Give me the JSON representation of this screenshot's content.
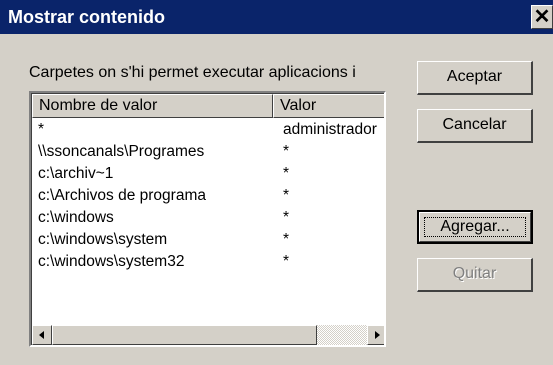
{
  "window": {
    "title": "Mostrar contenido",
    "close_glyph": "✕"
  },
  "caption": "Carpetes on s'hi permet executar aplicacions i",
  "list": {
    "headers": {
      "name": "Nombre de valor",
      "value": "Valor"
    },
    "rows": [
      {
        "name": "*",
        "value": "administrador"
      },
      {
        "name": "\\\\ssoncanals\\Programes",
        "value": "*"
      },
      {
        "name": "c:\\archiv~1",
        "value": "*"
      },
      {
        "name": "c:\\Archivos de programa",
        "value": "*"
      },
      {
        "name": "c:\\windows",
        "value": "*"
      },
      {
        "name": "c:\\windows\\system",
        "value": "*"
      },
      {
        "name": "c:\\windows\\system32",
        "value": "*"
      }
    ]
  },
  "buttons": {
    "accept": "Aceptar",
    "cancel": "Cancelar",
    "add": "Agregar...",
    "remove": "Quitar"
  },
  "colors": {
    "titlebar": "#0a246a",
    "face": "#d4d0c8",
    "disabled_text": "#808080"
  }
}
